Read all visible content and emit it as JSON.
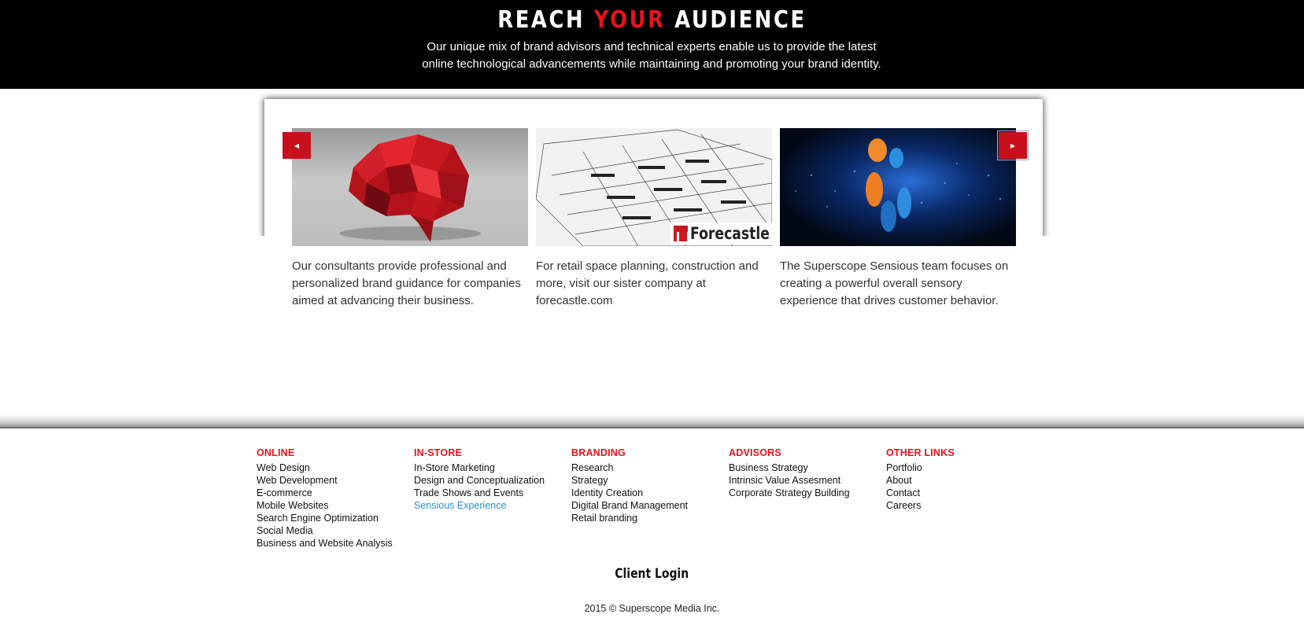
{
  "hero": {
    "title_pre": "REACH ",
    "title_accent": "YOUR",
    "title_post": " AUDIENCE",
    "subtitle": "Our unique mix of brand advisors and technical experts enable us to provide the latest online technological advancements while maintaining and promoting your brand identity."
  },
  "carousel": {
    "prev_icon": "◂",
    "next_icon": "▸",
    "slides": [
      {
        "image": "red-lowpoly-brain",
        "caption": "Our consultants provide professional and personalized brand guidance for companies aimed at advancing their business."
      },
      {
        "image": "warehouse-wireframe",
        "logo_text": "Forecastle",
        "caption": "For retail space planning, construction and more, visit our sister company at forecastle.com"
      },
      {
        "image": "blue-particles-orange-dots",
        "caption": "The Superscope Sensious team focuses on creating a powerful overall sensory experience that drives customer behavior."
      }
    ]
  },
  "footer": {
    "columns": [
      {
        "heading": "ONLINE",
        "links": [
          "Web Design",
          "Web Development",
          "E-commerce",
          "Mobile Websites",
          "Search Engine Optimization",
          "Social Media",
          "Business and Website Analysis"
        ]
      },
      {
        "heading": "IN-STORE",
        "links": [
          "In-Store Marketing",
          "Design and Conceptualization",
          "Trade Shows and Events",
          "Sensious Experience"
        ]
      },
      {
        "heading": "BRANDING",
        "links": [
          "Research",
          "Strategy",
          "Identity Creation",
          "Digital Brand Management",
          "Retail branding"
        ]
      },
      {
        "heading": "ADVISORS",
        "links": [
          "Business Strategy",
          "Intrinsic Value Assesment",
          "Corporate Strategy Building"
        ]
      },
      {
        "heading": "OTHER LINKS",
        "links": [
          "Portfolio",
          "About",
          "Contact",
          "Careers"
        ]
      }
    ],
    "client_login": "Client Login",
    "copyright": "2015 © Superscope Media Inc."
  },
  "colors": {
    "accent": "#e3141b",
    "arrow": "#c8101c",
    "active_link": "#2a8fd0",
    "hero_bg": "#000000"
  }
}
